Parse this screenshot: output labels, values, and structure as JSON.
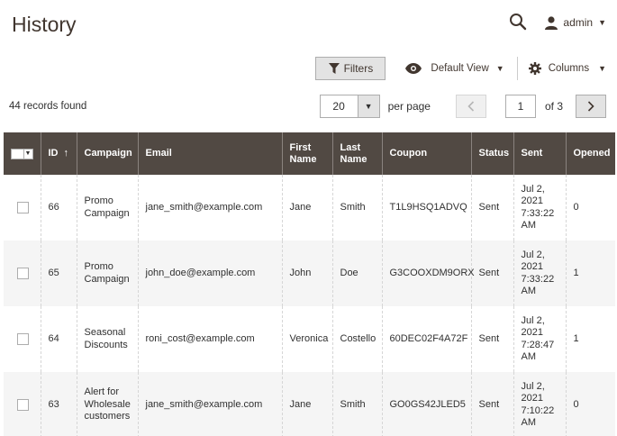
{
  "header": {
    "title": "History",
    "user_label": "admin"
  },
  "toolbar": {
    "filters_label": "Filters",
    "view_label": "Default View",
    "columns_label": "Columns"
  },
  "records_label": "44 records found",
  "pager": {
    "per_page_value": "20",
    "per_page_label": "per page",
    "current_page": "1",
    "of_label": "of 3"
  },
  "columns": {
    "id": "ID",
    "campaign": "Campaign",
    "email": "Email",
    "first_name": "First Name",
    "last_name": "Last Name",
    "coupon": "Coupon",
    "status": "Status",
    "sent": "Sent",
    "opened": "Opened"
  },
  "rows": [
    {
      "id": "66",
      "campaign": "Promo Campaign",
      "email": "jane_smith@example.com",
      "first_name": "Jane",
      "last_name": "Smith",
      "coupon": "T1L9HSQ1ADVQ",
      "status": "Sent",
      "sent": "Jul 2, 2021 7:33:22 AM",
      "opened": "0"
    },
    {
      "id": "65",
      "campaign": "Promo Campaign",
      "email": "john_doe@example.com",
      "first_name": "John",
      "last_name": "Doe",
      "coupon": "G3COOXDM9ORX",
      "status": "Sent",
      "sent": "Jul 2, 2021 7:33:22 AM",
      "opened": "1"
    },
    {
      "id": "64",
      "campaign": "Seasonal Discounts",
      "email": "roni_cost@example.com",
      "first_name": "Veronica",
      "last_name": "Costello",
      "coupon": "60DEC02F4A72F",
      "status": "Sent",
      "sent": "Jul 2, 2021 7:28:47 AM",
      "opened": "1"
    },
    {
      "id": "63",
      "campaign": "Alert for Wholesale customers",
      "email": "jane_smith@example.com",
      "first_name": "Jane",
      "last_name": "Smith",
      "coupon": "GO0GS42JLED5",
      "status": "Sent",
      "sent": "Jul 2, 2021 7:10:22 AM",
      "opened": "0"
    }
  ]
}
